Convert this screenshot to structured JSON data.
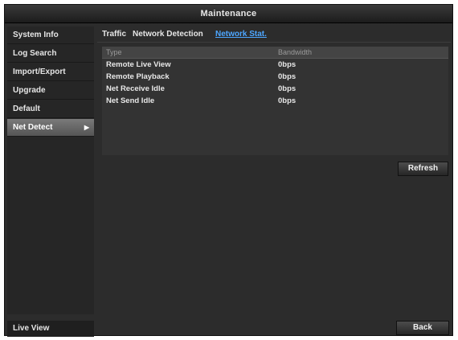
{
  "window": {
    "title": "Maintenance"
  },
  "sidebar": {
    "items": [
      {
        "label": "System Info"
      },
      {
        "label": "Log Search"
      },
      {
        "label": "Import/Export"
      },
      {
        "label": "Upgrade"
      },
      {
        "label": "Default"
      },
      {
        "label": "Net Detect",
        "selected": true,
        "arrow": "▶"
      }
    ],
    "live_view": "Live View"
  },
  "tabs": [
    {
      "label": "Traffic"
    },
    {
      "label": "Network Detection"
    },
    {
      "label": "Network Stat.",
      "active": true
    }
  ],
  "table": {
    "headers": [
      "Type",
      "Bandwidth"
    ],
    "rows": [
      [
        "Remote Live View",
        "0bps"
      ],
      [
        "Remote Playback",
        "0bps"
      ],
      [
        "Net Receive Idle",
        "0bps"
      ],
      [
        "Net Send Idle",
        "0bps"
      ]
    ]
  },
  "buttons": {
    "refresh": "Refresh",
    "back": "Back"
  },
  "colors": {
    "active_tab": "#4da6ff",
    "background": "#2c2c2c"
  }
}
